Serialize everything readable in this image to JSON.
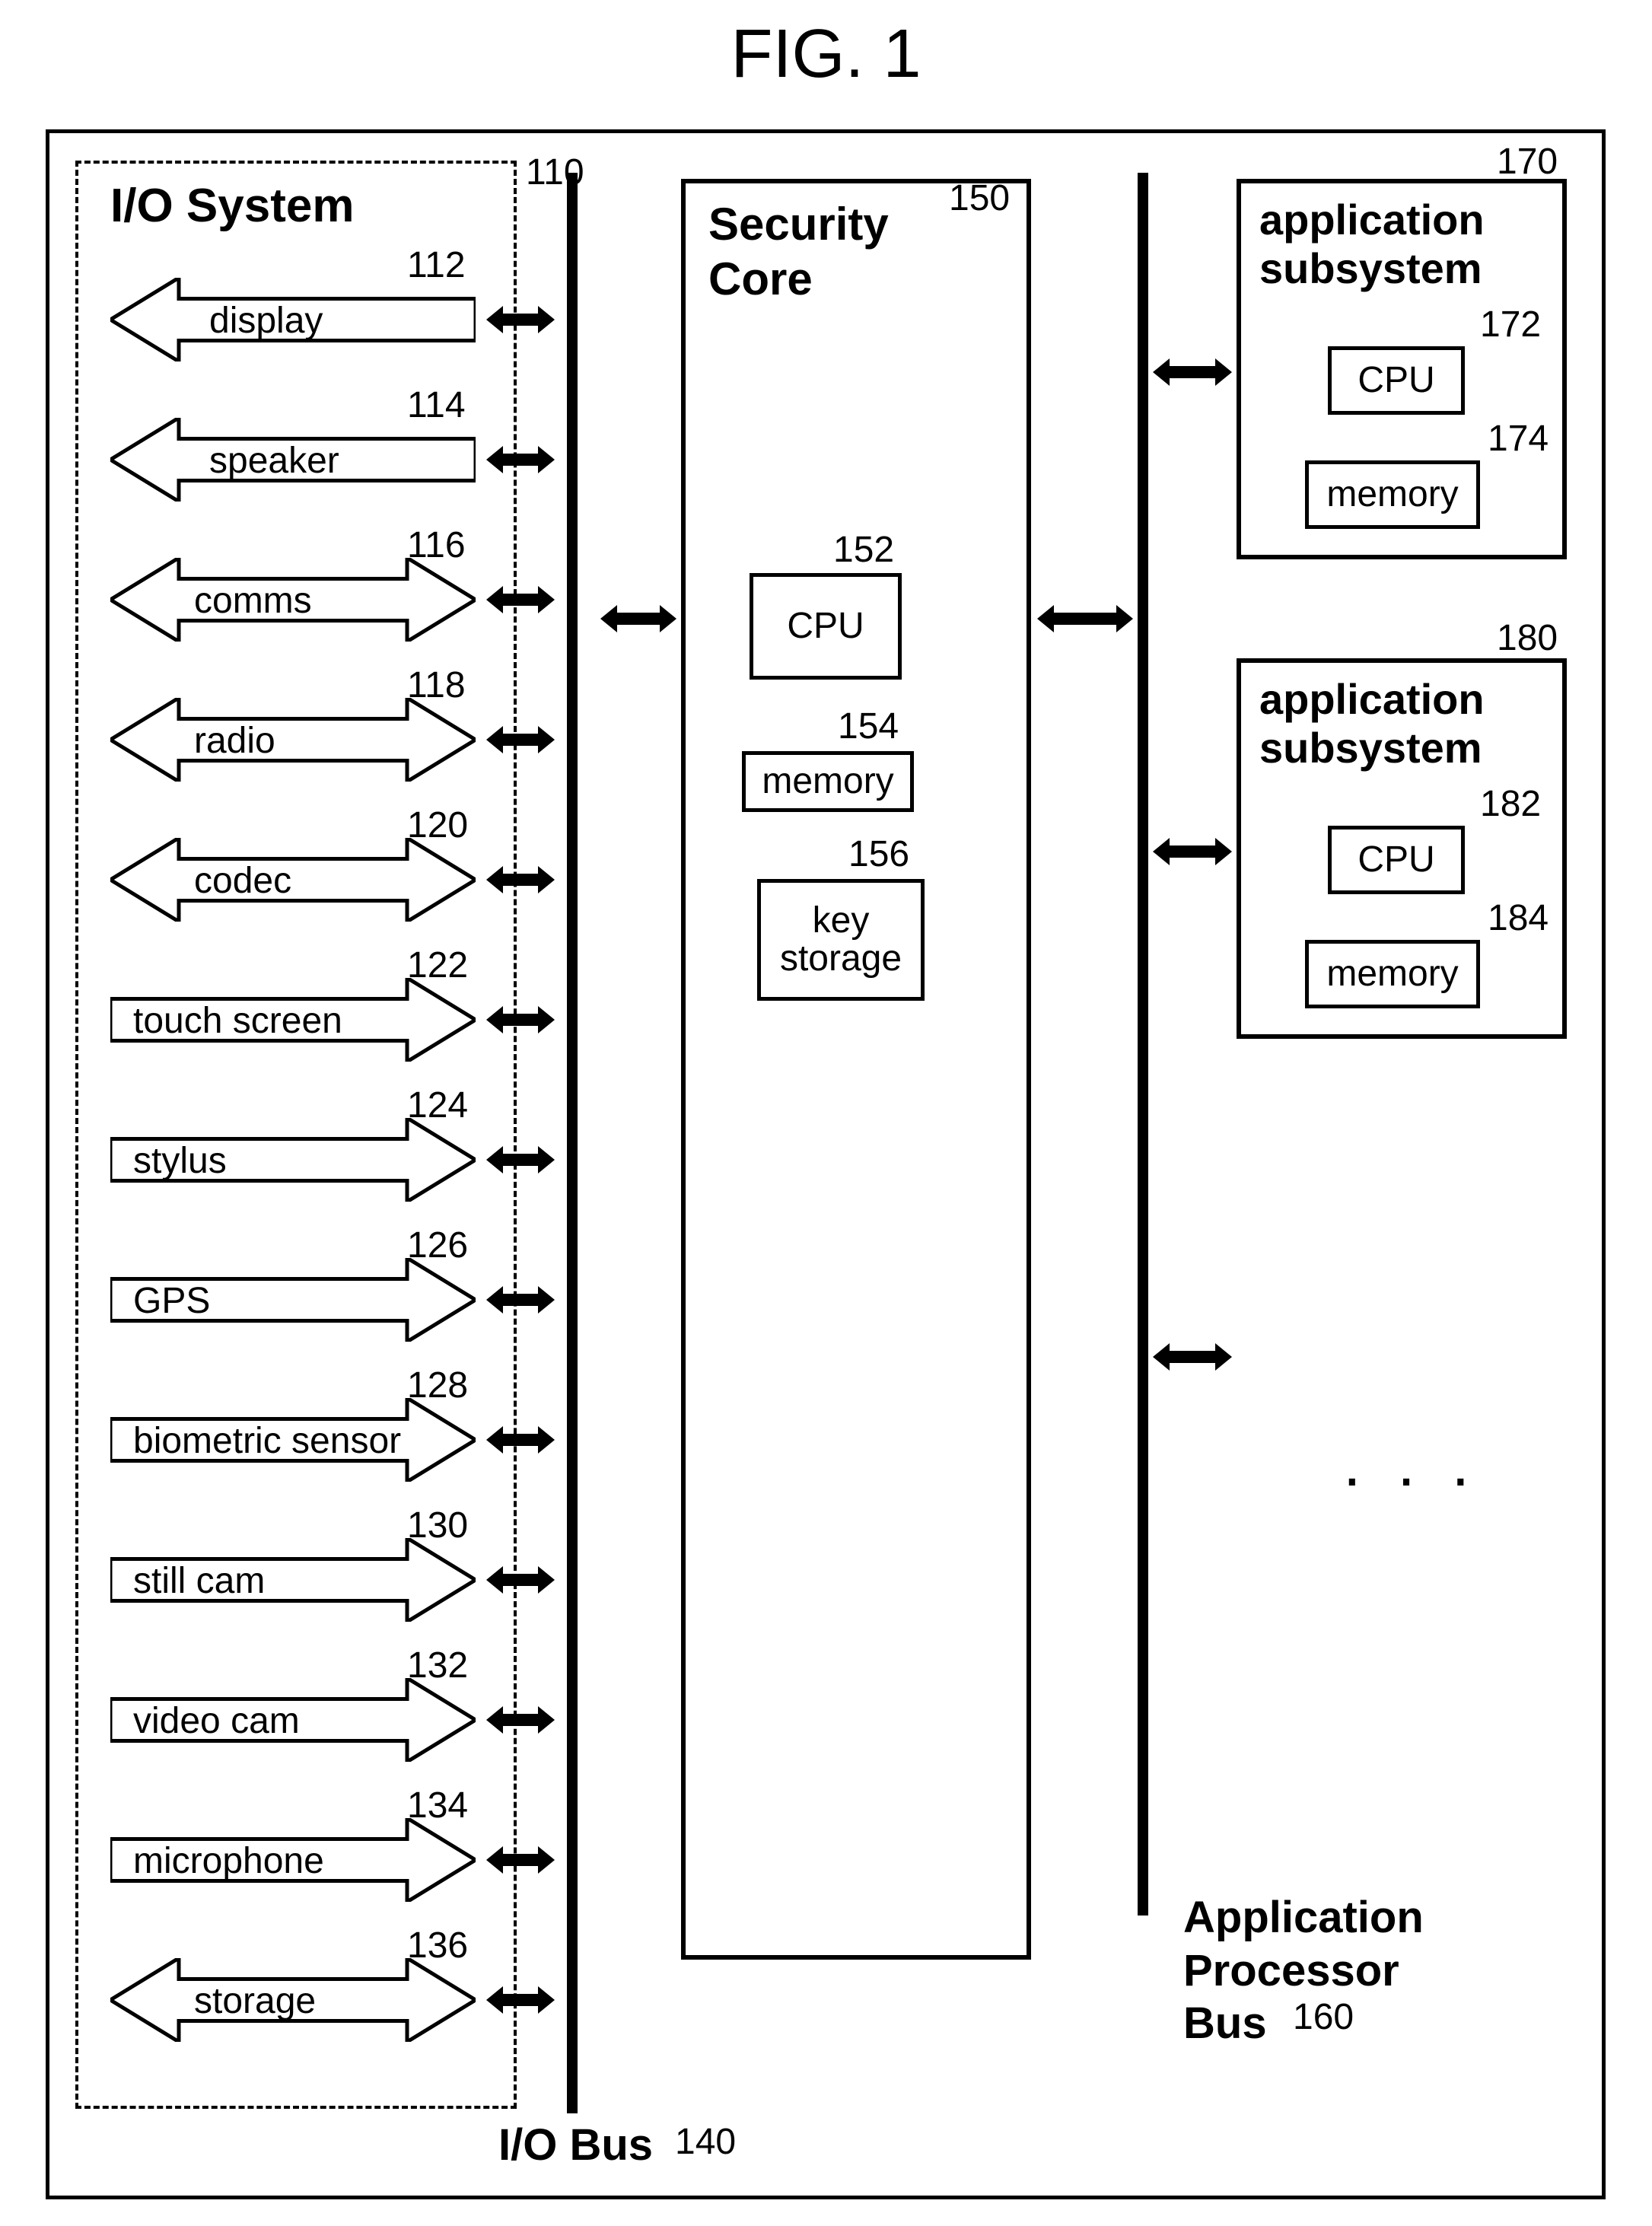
{
  "figure_title": "FIG. 1",
  "io_system": {
    "title": "I/O System",
    "ref": "110",
    "devices": [
      {
        "label": "display",
        "ref": "112",
        "dir": "left"
      },
      {
        "label": "speaker",
        "ref": "114",
        "dir": "left"
      },
      {
        "label": "comms",
        "ref": "116",
        "dir": "bidir"
      },
      {
        "label": "radio",
        "ref": "118",
        "dir": "bidir"
      },
      {
        "label": "codec",
        "ref": "120",
        "dir": "bidir"
      },
      {
        "label": "touch screen",
        "ref": "122",
        "dir": "right"
      },
      {
        "label": "stylus",
        "ref": "124",
        "dir": "right"
      },
      {
        "label": "GPS",
        "ref": "126",
        "dir": "right"
      },
      {
        "label": "biometric sensor",
        "ref": "128",
        "dir": "right"
      },
      {
        "label": "still cam",
        "ref": "130",
        "dir": "right"
      },
      {
        "label": "video cam",
        "ref": "132",
        "dir": "right"
      },
      {
        "label": "microphone",
        "ref": "134",
        "dir": "right"
      },
      {
        "label": "storage",
        "ref": "136",
        "dir": "bidir"
      }
    ]
  },
  "io_bus": {
    "label": "I/O Bus",
    "ref": "140"
  },
  "security_core": {
    "title": "Security\nCore",
    "ref": "150",
    "cpu": {
      "label": "CPU",
      "ref": "152"
    },
    "memory": {
      "label": "memory",
      "ref": "154"
    },
    "key_storage": {
      "label": "key\nstorage",
      "ref": "156"
    }
  },
  "app_bus": {
    "label": "Application\nProcessor\nBus",
    "ref": "160"
  },
  "app_sub_1": {
    "title": "application\nsubsystem",
    "ref": "170",
    "cpu": {
      "label": "CPU",
      "ref": "172"
    },
    "memory": {
      "label": "memory",
      "ref": "174"
    }
  },
  "app_sub_2": {
    "title": "application\nsubsystem",
    "ref": "180",
    "cpu": {
      "label": "CPU",
      "ref": "182"
    },
    "memory": {
      "label": "memory",
      "ref": "184"
    }
  },
  "ellipsis": ". . ."
}
